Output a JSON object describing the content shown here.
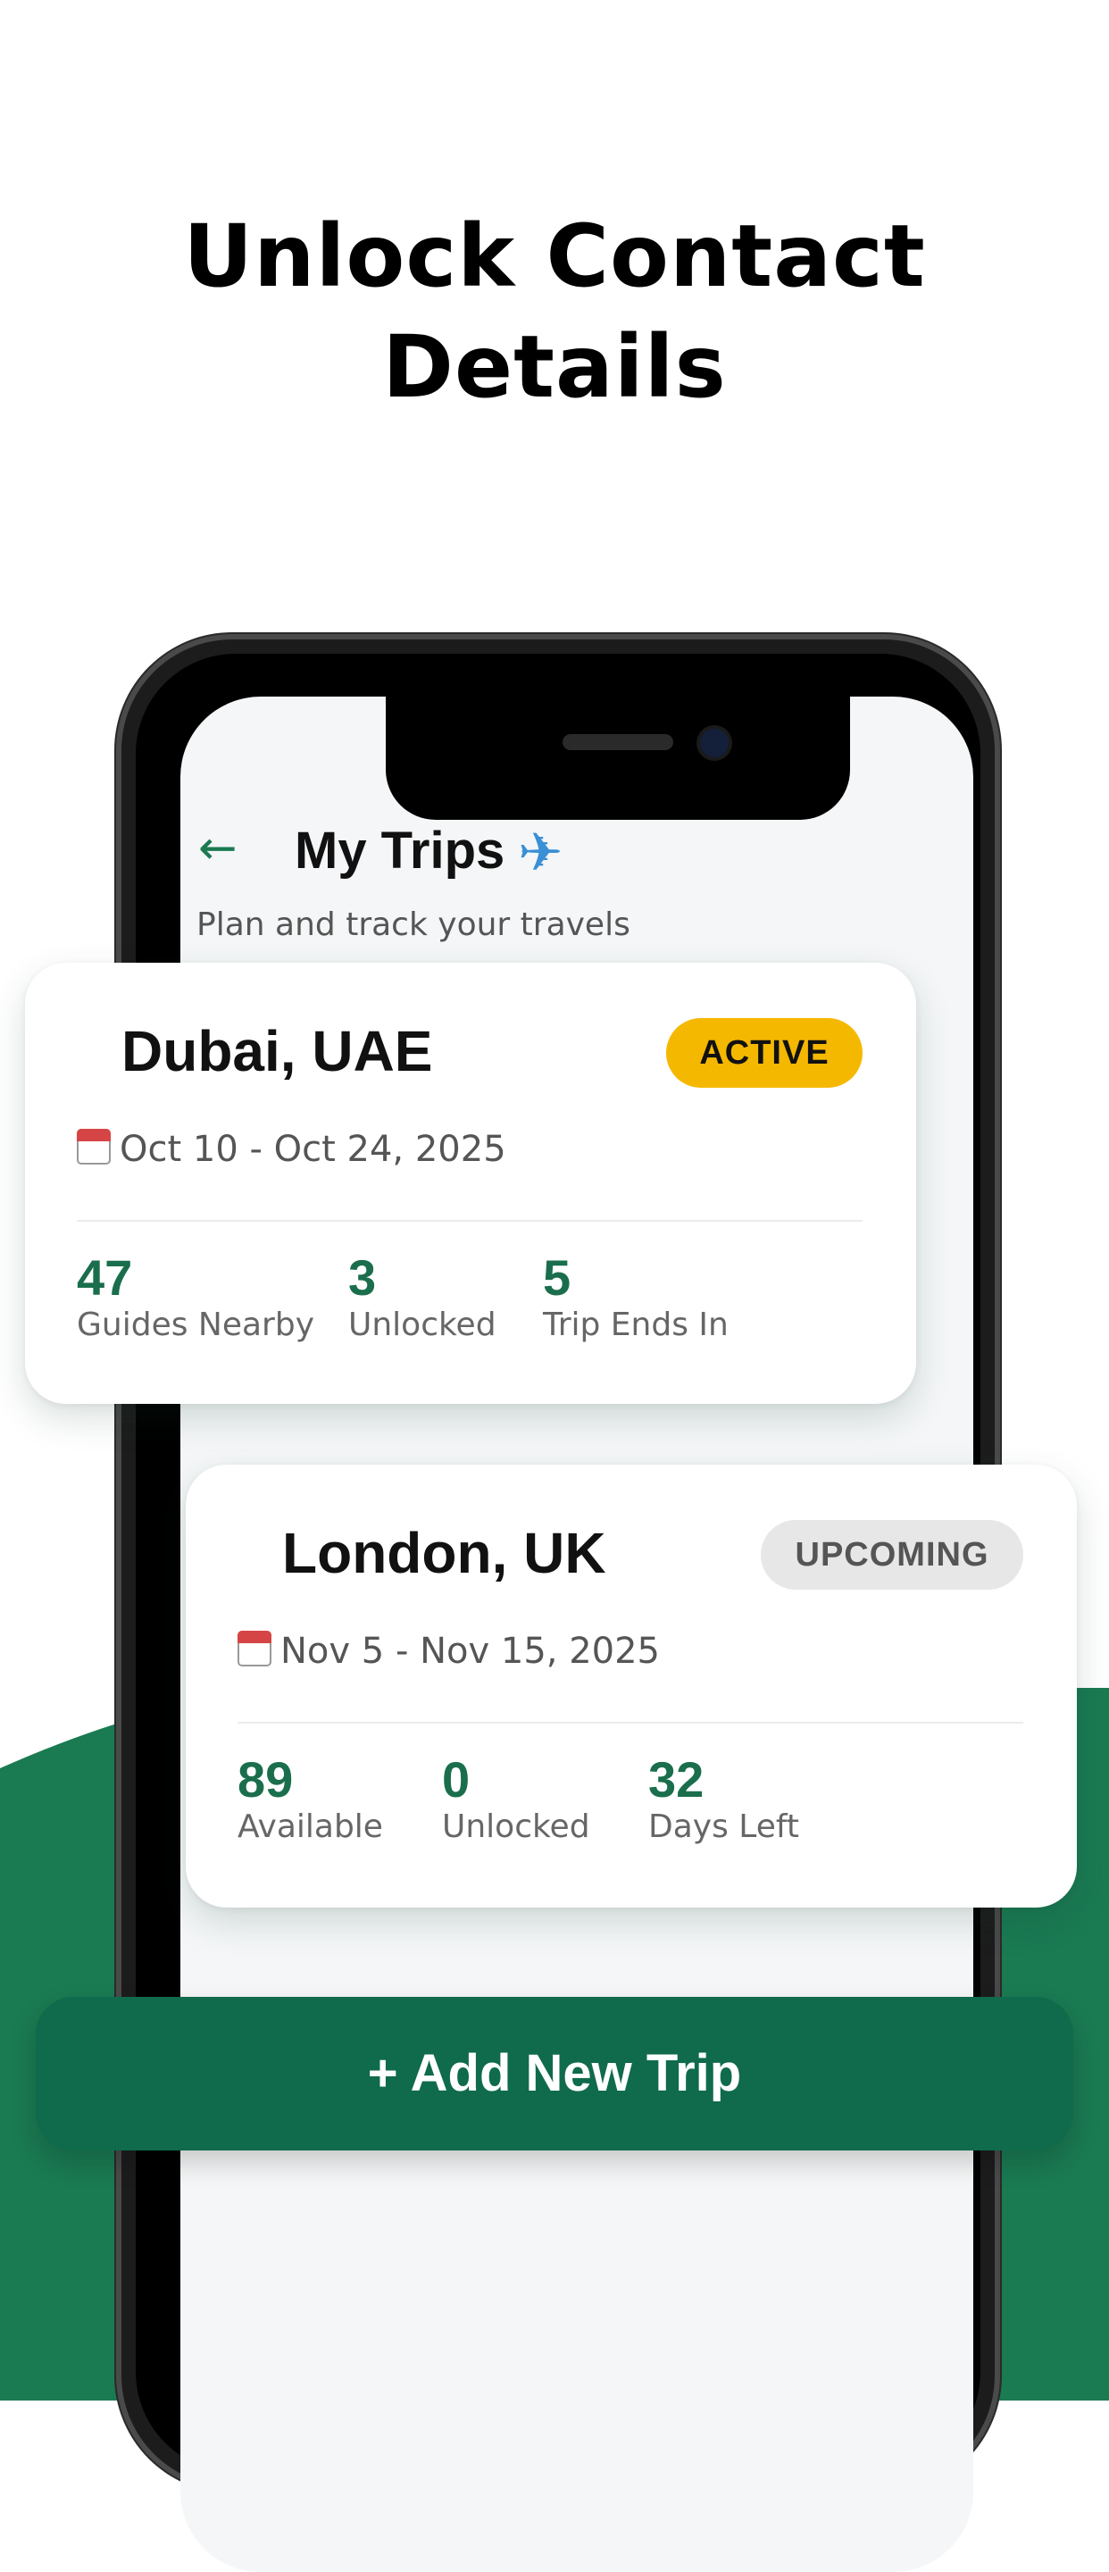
{
  "headline": {
    "line1": "Unlock Contact",
    "line2": "Details"
  },
  "screen": {
    "back_icon": "back-arrow-icon",
    "title": "My Trips",
    "title_icon": "airplane-icon",
    "subtitle": "Plan and track your travels"
  },
  "trips": [
    {
      "city": "Dubai, UAE",
      "status": "ACTIVE",
      "dates": "Oct 10 - Oct 24, 2025",
      "stats": [
        {
          "value": "47",
          "label": "Guides Nearby"
        },
        {
          "value": "3",
          "label": "Unlocked"
        },
        {
          "value": "5",
          "label": "Trip Ends In"
        }
      ]
    },
    {
      "city": "London, UK",
      "status": "UPCOMING",
      "dates": "Nov 5 - Nov 15, 2025",
      "stats": [
        {
          "value": "89",
          "label": "Available"
        },
        {
          "value": "0",
          "label": "Unlocked"
        },
        {
          "value": "32",
          "label": "Days Left"
        }
      ]
    }
  ],
  "add_button": {
    "label": "+ Add New Trip"
  },
  "colors": {
    "brand_green": "#0f6b4b",
    "stat_green": "#1a6e4c",
    "active_badge": "#f5b800",
    "upcoming_badge": "#e7e7e7"
  }
}
